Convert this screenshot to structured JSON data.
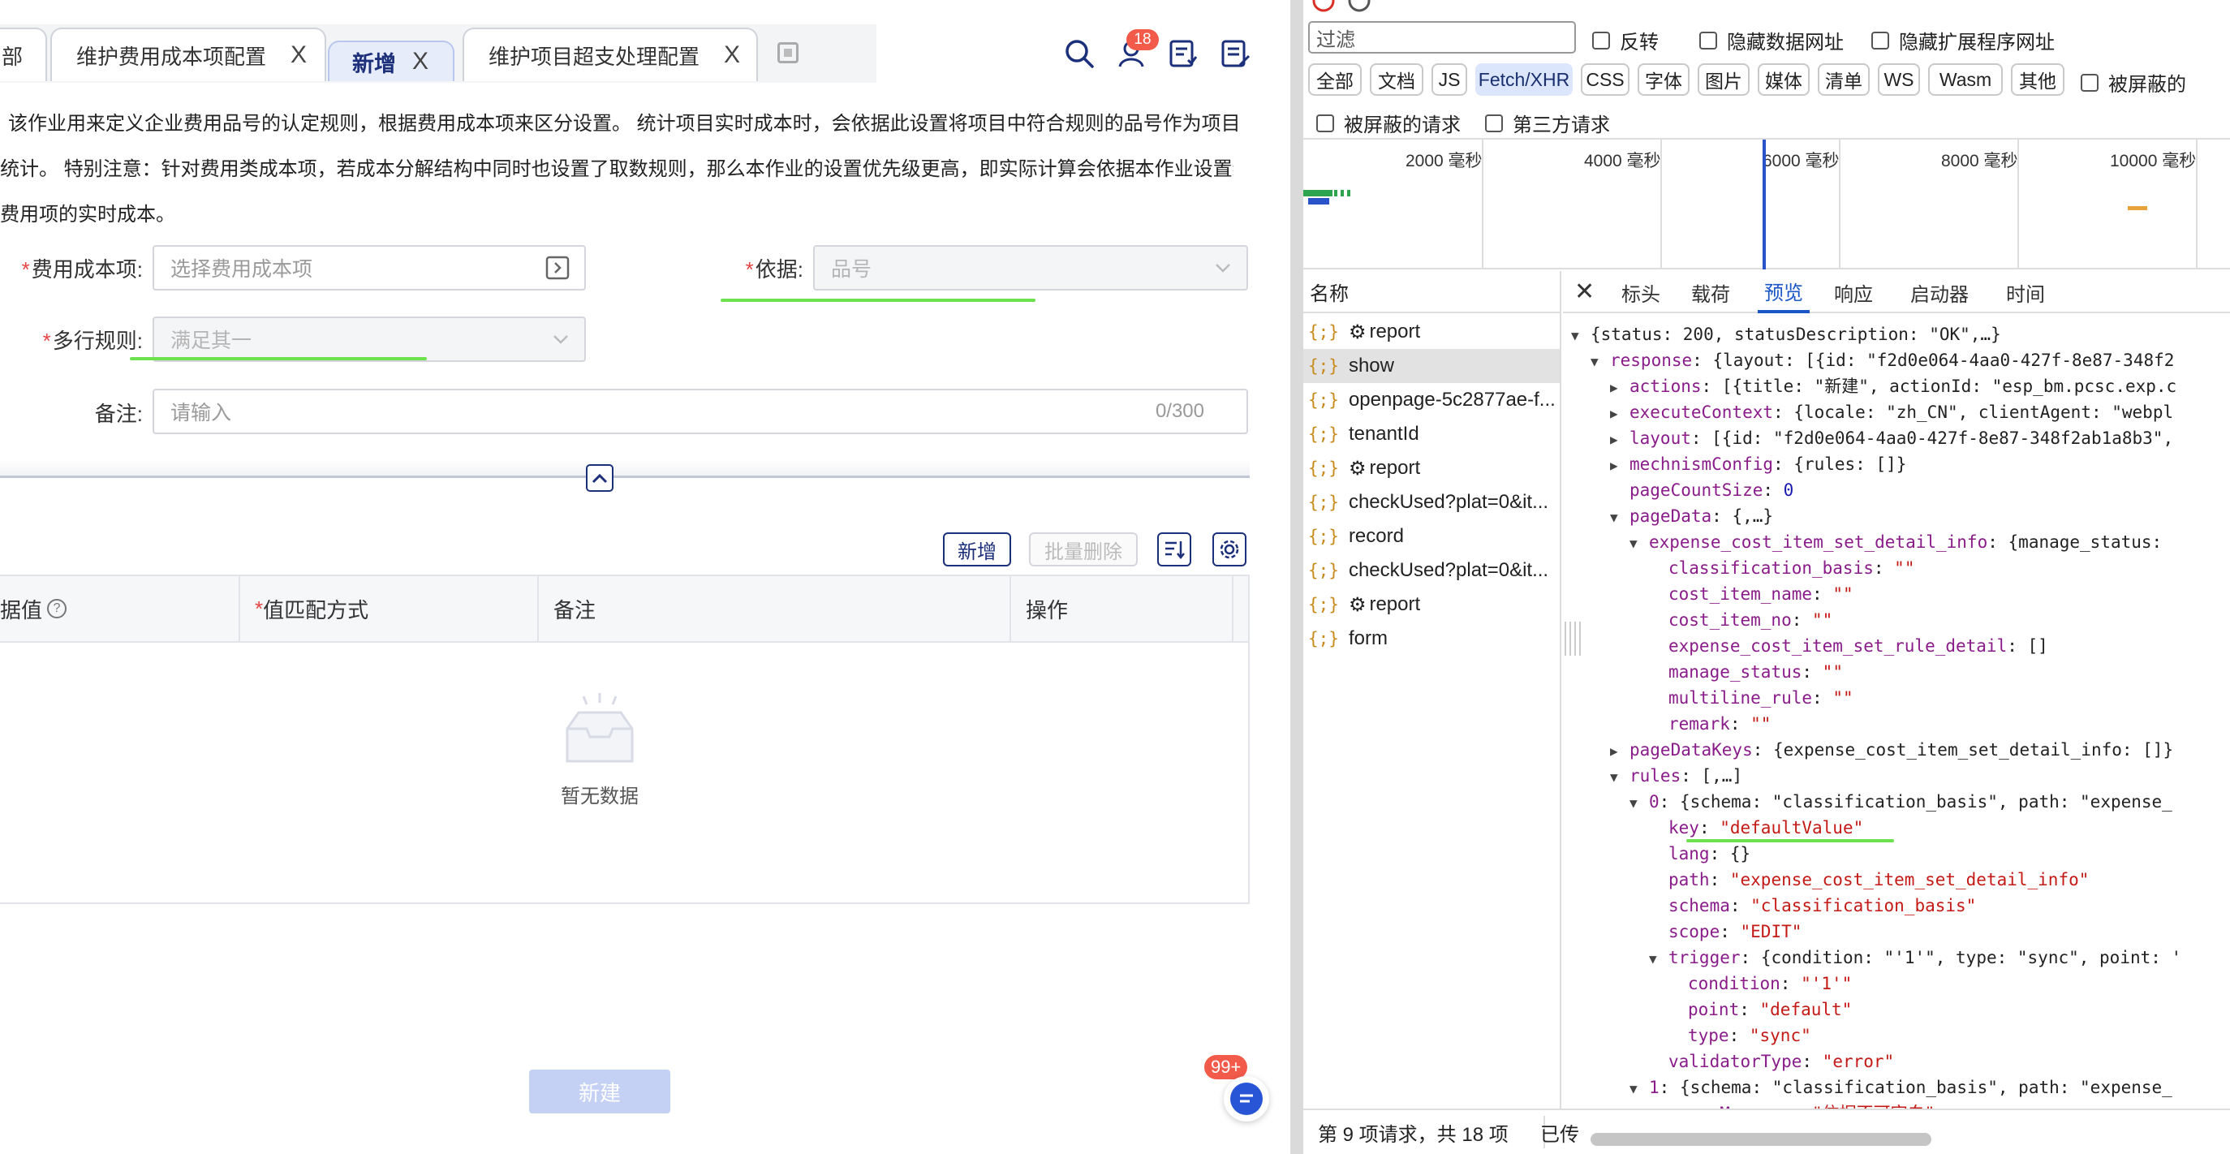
{
  "app": {
    "tabs": [
      {
        "label": "部"
      },
      {
        "label": "维护费用成本项配置"
      },
      {
        "label": "新增"
      },
      {
        "label": "维护项目超支处理配置"
      }
    ],
    "close_glyph": "X",
    "notification_count": "18",
    "description_lines": [
      "该作业用来定义企业费用品号的认定规则，根据费用成本项来区分设置。 统计项目实时成本时，会依据此设置将项目中符合规则的品号作为项目",
      "统计。 特别注意：针对费用类成本项，若成本分解结构中同时也设置了取数规则，那么本作业的设置优先级更高，即实际计算会依据本作业设置统",
      "费用项的实时成本。"
    ],
    "form": {
      "cost_item_label": "费用成本项:",
      "cost_item_placeholder": "选择费用成本项",
      "basis_label": "依据:",
      "basis_value": "品号",
      "multiline_label": "多行规则:",
      "multiline_value": "满足其一",
      "remark_label": "备注:",
      "remark_placeholder": "请输入",
      "remark_counter": "0/300",
      "required_mark": "*"
    },
    "table_toolbar": {
      "add_label": "新增",
      "batch_delete_label": "批量删除"
    },
    "table": {
      "columns": [
        "据值",
        "值匹配方式",
        "备注",
        "操作"
      ],
      "empty_text": "暂无数据"
    },
    "submit_label": "新建",
    "float_badge": "99+"
  },
  "devtools": {
    "filter_placeholder": "过滤",
    "checkbox_invert": "反转",
    "checkbox_hide_data_urls": "隐藏数据网址",
    "checkbox_hide_ext_urls": "隐藏扩展程序网址",
    "type_chips": [
      "全部",
      "文档",
      "JS",
      "Fetch/XHR",
      "CSS",
      "字体",
      "图片",
      "媒体",
      "清单",
      "WS",
      "Wasm",
      "其他"
    ],
    "active_chip": "Fetch/XHR",
    "checkbox_blocked_cookies": "被屏蔽的",
    "checkbox_blocked_requests": "被屏蔽的请求",
    "checkbox_third_party": "第三方请求",
    "timeline_labels": [
      "2000 毫秒",
      "4000 毫秒",
      "6000 毫秒",
      "8000 毫秒",
      "10000 毫秒"
    ],
    "names_header": "名称",
    "requests": [
      {
        "name": "report",
        "gear": true
      },
      {
        "name": "show",
        "gear": false
      },
      {
        "name": "openpage-5c2877ae-f...",
        "gear": false
      },
      {
        "name": "tenantId",
        "gear": false
      },
      {
        "name": "report",
        "gear": true
      },
      {
        "name": "checkUsed?plat=0&it...",
        "gear": false
      },
      {
        "name": "record",
        "gear": false
      },
      {
        "name": "checkUsed?plat=0&it...",
        "gear": false
      },
      {
        "name": "report",
        "gear": true
      },
      {
        "name": "form",
        "gear": false
      }
    ],
    "selected_request": "show",
    "detail_tabs": [
      "标头",
      "载荷",
      "预览",
      "响应",
      "启动器",
      "时间"
    ],
    "active_detail_tab": "预览",
    "status_text": "第 9 项请求，共 18 项",
    "status_transferred": "已传",
    "tree": {
      "l0": "{status: 200, statusDescription: \"OK\",…}",
      "l1_key": "response",
      "l1_val": "{layout: [{id: \"f2d0e064-4aa0-427f-8e87-348f2",
      "actions_key": "actions",
      "actions_val": "[{title: \"新建\", actionId: \"esp_bm.pcsc.exp.c",
      "exec_key": "executeContext",
      "exec_val": "{locale: \"zh_CN\", clientAgent: \"webpl",
      "layout_key": "layout",
      "layout_val": "[{id: \"f2d0e064-4aa0-427f-8e87-348f2ab1a8b3\",",
      "mech_key": "mechnismConfig",
      "mech_val": "{rules: []}",
      "pcs_key": "pageCountSize",
      "pcs_val": "0",
      "pd_key": "pageData",
      "pd_val": "{,…}",
      "ecis_key": "expense_cost_item_set_detail_info",
      "ecis_val": "{manage_status:",
      "cb_key": "classification_basis",
      "cin_key": "cost_item_name",
      "cino_key": "cost_item_no",
      "ecisr_key": "expense_cost_item_set_rule_detail",
      "ecisr_val": "[]",
      "ms_key": "manage_status",
      "mr_key": "multiline_rule",
      "rm_key": "remark",
      "empty_str": "\"\"",
      "pdk_key": "pageDataKeys",
      "pdk_val": "{expense_cost_item_set_detail_info: []}",
      "rules_key": "rules",
      "rules_val": "[,…]",
      "r0_key": "0",
      "r0_val": "{schema: \"classification_basis\", path: \"expense_",
      "key_key": "key",
      "key_val": "\"defaultValue\"",
      "lang_key": "lang",
      "lang_val": "{}",
      "path_key": "path",
      "path_val": "\"expense_cost_item_set_detail_info\"",
      "schema_key": "schema",
      "schema_val": "\"classification_basis\"",
      "scope_key": "scope",
      "scope_val": "\"EDIT\"",
      "trigger_key": "trigger",
      "trigger_val": "{condition: \"'1'\", type: \"sync\", point: '",
      "cond_key": "condition",
      "cond_val": "\"'1'\"",
      "point_key": "point",
      "point_val": "\"default\"",
      "type_key": "type",
      "type_val": "\"sync\"",
      "vt_key": "validatorType",
      "vt_val": "\"error\"",
      "r1_key": "1",
      "r1_val": "{schema: \"classification_basis\", path: \"expense_",
      "em_key": "errorMessage",
      "em_val": "\"依据不可空白\""
    }
  },
  "colors": {
    "brand": "#1c2f7a",
    "required": "#e54545",
    "highlight_underline": "#6ee24e",
    "devtools_accent": "#1a56c8",
    "json_key": "#8a1c8a",
    "json_string": "#c41a16"
  }
}
